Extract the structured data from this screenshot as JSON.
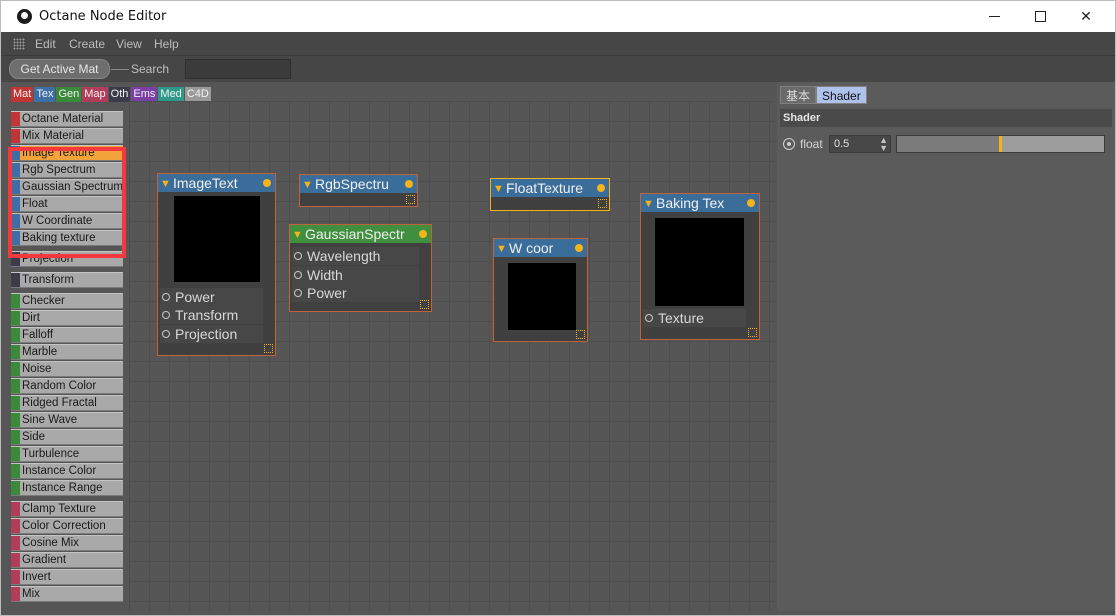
{
  "window": {
    "title": "Octane Node Editor"
  },
  "menu": {
    "items": [
      "Edit",
      "Create",
      "View",
      "Help"
    ]
  },
  "toolbar": {
    "get_active_mat": "Get Active Mat",
    "search_label": "Search",
    "search_value": ""
  },
  "categories": [
    {
      "label": "Mat",
      "color": "#c03535"
    },
    {
      "label": "Tex",
      "color": "#3d6fa6"
    },
    {
      "label": "Gen",
      "color": "#3b8a3b"
    },
    {
      "label": "Map",
      "color": "#b03e5a"
    },
    {
      "label": "Oth",
      "color": "#3b3b4a"
    },
    {
      "label": "Ems",
      "color": "#7b3fa6"
    },
    {
      "label": "Med",
      "color": "#2f9a8a"
    },
    {
      "label": "C4D",
      "color": "#9a9a9a"
    }
  ],
  "node_list": [
    {
      "label": "Octane Material",
      "color": "#c03535"
    },
    {
      "label": "Mix Material",
      "color": "#c03535"
    },
    {
      "label": "Image Texture",
      "color": "#3d6fa6",
      "selected": true
    },
    {
      "label": "Rgb Spectrum",
      "color": "#3d6fa6"
    },
    {
      "label": "Gaussian Spectrum",
      "color": "#3d6fa6"
    },
    {
      "label": "Float",
      "color": "#3d6fa6"
    },
    {
      "label": "W Coordinate",
      "color": "#3d6fa6"
    },
    {
      "label": "Baking texture",
      "color": "#3d6fa6"
    },
    {
      "label": "Projection",
      "color": "#3b3b4a"
    },
    {
      "label": "Transform",
      "color": "#3b3b4a"
    },
    {
      "label": "Checker",
      "color": "#3b8a3b"
    },
    {
      "label": "Dirt",
      "color": "#3b8a3b"
    },
    {
      "label": "Falloff",
      "color": "#3b8a3b"
    },
    {
      "label": "Marble",
      "color": "#3b8a3b"
    },
    {
      "label": "Noise",
      "color": "#3b8a3b"
    },
    {
      "label": "Random Color",
      "color": "#3b8a3b"
    },
    {
      "label": "Ridged Fractal",
      "color": "#3b8a3b"
    },
    {
      "label": "Sine Wave",
      "color": "#3b8a3b"
    },
    {
      "label": "Side",
      "color": "#3b8a3b"
    },
    {
      "label": "Turbulence",
      "color": "#3b8a3b"
    },
    {
      "label": "Instance Color",
      "color": "#3b8a3b"
    },
    {
      "label": "Instance Range",
      "color": "#3b8a3b"
    },
    {
      "label": "Clamp Texture",
      "color": "#b03e5a"
    },
    {
      "label": "Color Correction",
      "color": "#b03e5a"
    },
    {
      "label": "Cosine Mix",
      "color": "#b03e5a"
    },
    {
      "label": "Gradient",
      "color": "#b03e5a"
    },
    {
      "label": "Invert",
      "color": "#b03e5a"
    },
    {
      "label": "Mix",
      "color": "#b03e5a"
    }
  ],
  "nodes": {
    "image_texture": {
      "title": "ImageText",
      "ports": [
        "Power",
        "Transform",
        "Projection"
      ]
    },
    "rgb_spectrum": {
      "title": "RgbSpectru"
    },
    "gaussian": {
      "title": "GaussianSpectr",
      "ports": [
        "Wavelength",
        "Width",
        "Power"
      ]
    },
    "float_texture": {
      "title": "FloatTexture"
    },
    "w_coord": {
      "title": "W coor"
    },
    "baking": {
      "title": "Baking Tex",
      "ports": [
        "Texture"
      ]
    }
  },
  "colors": {
    "tex_header": "#3b6d9a",
    "gen_header": "#3f8f3f",
    "accent": "#f5b31a",
    "highlight": "#f4383e"
  },
  "right_panel": {
    "tabs": [
      "基本",
      "Shader"
    ],
    "active_tab": "Shader",
    "section_title": "Shader",
    "param": {
      "label": "float",
      "value": "0.5",
      "level": 0.5
    }
  }
}
